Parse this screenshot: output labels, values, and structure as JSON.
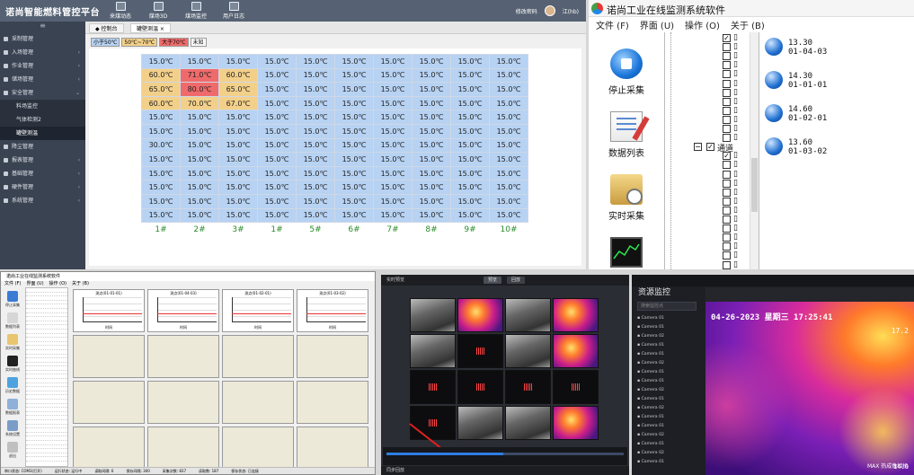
{
  "panel1": {
    "app_title": "诺尚智能燃料管控平台",
    "top_nav": [
      "来煤动态",
      "煤场3D",
      "煤场监控",
      "用户日志"
    ],
    "top_right": [
      "修改密码",
      "江(hb)"
    ],
    "sidebar": [
      {
        "label": "采制管理",
        "chevron": ""
      },
      {
        "label": "入场管理",
        "chevron": "‹"
      },
      {
        "label": "作业管理",
        "chevron": "‹"
      },
      {
        "label": "储场管理",
        "chevron": "‹"
      },
      {
        "label": "安全管理",
        "chevron": "⌄"
      }
    ],
    "sidebar_sub": [
      "料场监控",
      "气体检测2",
      "罐壁测温"
    ],
    "sidebar_after": [
      {
        "label": "降尘管理",
        "chevron": ""
      },
      {
        "label": "报表管理",
        "chevron": "‹"
      },
      {
        "label": "基础管理",
        "chevron": "‹"
      },
      {
        "label": "硬件管理",
        "chevron": "‹"
      },
      {
        "label": "系统管理",
        "chevron": "‹"
      }
    ],
    "tabs": [
      "控制台",
      "罐壁测温"
    ],
    "legend": [
      {
        "label": "小于50℃",
        "color": "#b7d2f2"
      },
      {
        "label": "50℃~70℃",
        "color": "#f3d08a"
      },
      {
        "label": "大于70℃",
        "color": "#ef6b6b"
      },
      {
        "label": "未知",
        "color": "#ffffff"
      }
    ],
    "grid": [
      [
        "15.0℃",
        "15.0℃",
        "15.0℃",
        "15.0℃",
        "15.0℃",
        "15.0℃",
        "15.0℃",
        "15.0℃",
        "15.0℃",
        "15.0℃"
      ],
      [
        "60.0℃",
        "71.0℃",
        "60.0℃",
        "15.0℃",
        "15.0℃",
        "15.0℃",
        "15.0℃",
        "15.0℃",
        "15.0℃",
        "15.0℃"
      ],
      [
        "65.0℃",
        "80.0℃",
        "65.0℃",
        "15.0℃",
        "15.0℃",
        "15.0℃",
        "15.0℃",
        "15.0℃",
        "15.0℃",
        "15.0℃"
      ],
      [
        "60.0℃",
        "70.0℃",
        "67.0℃",
        "15.0℃",
        "15.0℃",
        "15.0℃",
        "15.0℃",
        "15.0℃",
        "15.0℃",
        "15.0℃"
      ],
      [
        "15.0℃",
        "15.0℃",
        "15.0℃",
        "15.0℃",
        "15.0℃",
        "15.0℃",
        "15.0℃",
        "15.0℃",
        "15.0℃",
        "15.0℃"
      ],
      [
        "15.0℃",
        "15.0℃",
        "15.0℃",
        "15.0℃",
        "15.0℃",
        "15.0℃",
        "15.0℃",
        "15.0℃",
        "15.0℃",
        "15.0℃"
      ],
      [
        "30.0℃",
        "15.0℃",
        "15.0℃",
        "15.0℃",
        "15.0℃",
        "15.0℃",
        "15.0℃",
        "15.0℃",
        "15.0℃",
        "15.0℃"
      ],
      [
        "15.0℃",
        "15.0℃",
        "15.0℃",
        "15.0℃",
        "15.0℃",
        "15.0℃",
        "15.0℃",
        "15.0℃",
        "15.0℃",
        "15.0℃"
      ],
      [
        "15.0℃",
        "15.0℃",
        "15.0℃",
        "15.0℃",
        "15.0℃",
        "15.0℃",
        "15.0℃",
        "15.0℃",
        "15.0℃",
        "15.0℃"
      ],
      [
        "15.0℃",
        "15.0℃",
        "15.0℃",
        "15.0℃",
        "15.0℃",
        "15.0℃",
        "15.0℃",
        "15.0℃",
        "15.0℃",
        "15.0℃"
      ],
      [
        "15.0℃",
        "15.0℃",
        "15.0℃",
        "15.0℃",
        "15.0℃",
        "15.0℃",
        "15.0℃",
        "15.0℃",
        "15.0℃",
        "15.0℃"
      ],
      [
        "15.0℃",
        "15.0℃",
        "15.0℃",
        "15.0℃",
        "15.0℃",
        "15.0℃",
        "15.0℃",
        "15.0℃",
        "15.0℃",
        "15.0℃"
      ]
    ],
    "column_labels": [
      "1#",
      "2#",
      "3#",
      "1#",
      "5#",
      "6#",
      "7#",
      "8#",
      "9#",
      "10#"
    ]
  },
  "panel2": {
    "title": "诺尚工业在线监测系统软件",
    "menu": [
      "文件 (F)",
      "界面 (U)",
      "操作 (O)",
      "关于 (B)"
    ],
    "tools": [
      "停止采集",
      "数据列表",
      "实时采集"
    ],
    "channel_label": "通道",
    "sensors": [
      {
        "value": "13.30",
        "id": "01-04-03"
      },
      {
        "value": "14.30",
        "id": "01-01-01"
      },
      {
        "value": "14.60",
        "id": "01-02-01"
      },
      {
        "value": "13.60",
        "id": "01-03-02"
      }
    ]
  },
  "panel3": {
    "title": "诺尚工业在线监测系统软件",
    "menu": [
      "文件 (F)",
      "界面 (U)",
      "操作 (O)",
      "关于 (B)"
    ],
    "tools": [
      "停止采集",
      "数据列表",
      "实时采集",
      "实时曲线",
      "历史数据",
      "数据报表",
      "系统设置",
      "退出"
    ],
    "charts": [
      "测点(01-01-01)",
      "测点(01-04-03)",
      "测点(01-02-01)",
      "测点(01-03-02)"
    ],
    "x_axis": "时间",
    "status": [
      "串口状态: COM3(打开)",
      "运行状态: 运行中",
      "读取间隔: 6",
      "保存间隔: 300",
      "采集次数: 837",
      "读取数: 187",
      "保存状态: 已连接"
    ]
  },
  "panel4": {
    "top_label": "实时预览",
    "segments": [
      "预览",
      "回放"
    ],
    "bottom_label": "同步回放"
  },
  "panel5": {
    "title": "资源监控",
    "search_placeholder": "搜索监控点",
    "cameras": [
      "Camera 01",
      "Camera 01",
      "Camera 02",
      "Camera 01",
      "Camera 01",
      "Camera 02",
      "Camera 01",
      "Camera 01",
      "Camera 02",
      "Camera 01",
      "Camera 02",
      "Camera 01",
      "Camera 01",
      "Camera 02",
      "Camera 01",
      "Camera 02",
      "Camera 01"
    ],
    "timestamp": "04-26-2023 星期三 17:25:41",
    "max_value": "17.2",
    "max_label": "MAX 热成像相机",
    "min_value": "14.0"
  }
}
